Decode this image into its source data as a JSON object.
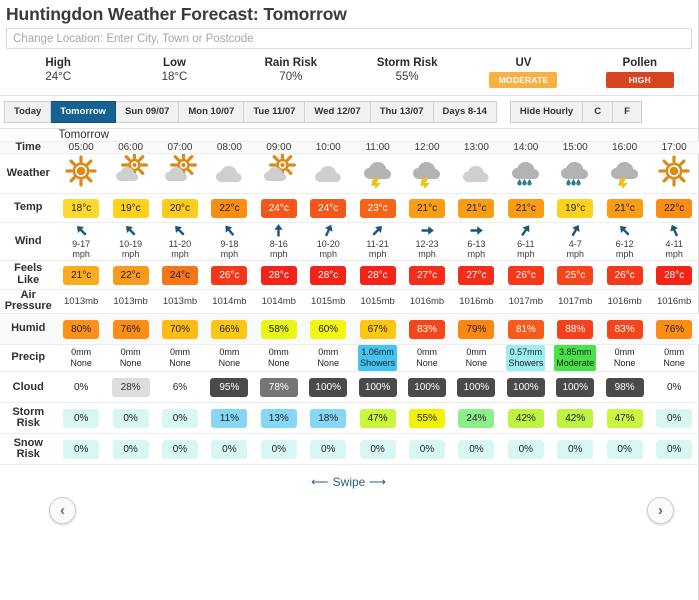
{
  "header": {
    "title": "Huntingdon Weather Forecast: Tomorrow",
    "search_placeholder": "Change Location: Enter City, Town or Postcode",
    "search_value": ""
  },
  "summary": [
    {
      "label": "High",
      "value": "24°C",
      "type": "text"
    },
    {
      "label": "Low",
      "value": "18°C",
      "type": "text"
    },
    {
      "label": "Rain Risk",
      "value": "70%",
      "type": "text"
    },
    {
      "label": "Storm Risk",
      "value": "55%",
      "type": "text"
    },
    {
      "label": "UV",
      "value": "MODERATE",
      "type": "badge",
      "color": "#F8B042"
    },
    {
      "label": "Pollen",
      "value": "HIGH",
      "type": "badge",
      "color": "#D6451F"
    }
  ],
  "tabs": {
    "days": [
      {
        "label": "Today",
        "active": false
      },
      {
        "label": "Tomorrow",
        "active": true
      },
      {
        "label": "Sun 09/07",
        "active": false
      },
      {
        "label": "Mon 10/07",
        "active": false
      },
      {
        "label": "Tue 11/07",
        "active": false
      },
      {
        "label": "Wed 12/07",
        "active": false
      },
      {
        "label": "Thu 13/07",
        "active": false
      },
      {
        "label": "Days 8-14",
        "active": false
      }
    ],
    "controls": [
      {
        "label": "Hide Hourly",
        "active": false
      },
      {
        "label": "C",
        "active": false
      },
      {
        "label": "F",
        "active": false
      }
    ],
    "active_tab_color": "#156192"
  },
  "nav": {
    "prev": "‹",
    "next": "›"
  },
  "footer": {
    "swipe_label": "Swipe",
    "left_arrow": "⟵",
    "right_arrow": "⟶"
  },
  "row_labels": {
    "time": "Time",
    "weather": "Weather",
    "temp": "Temp",
    "wind": "Wind",
    "feels_like": "Feels\nLike",
    "feels_like_l1": "Feels",
    "feels_like_l2": "Like",
    "pressure_l1": "Air",
    "pressure_l2": "Pressure",
    "humid": "Humid",
    "precip": "Precip",
    "cloud": "Cloud",
    "storm_l1": "Storm",
    "storm_l2": "Risk",
    "snow_l1": "Snow",
    "snow_l2": "Risk"
  },
  "day_banner": "Tomorrow",
  "chart_data": {
    "type": "table",
    "title": "Huntingdon Weather Forecast: Tomorrow",
    "categories": [
      "05:00",
      "06:00",
      "07:00",
      "08:00",
      "09:00",
      "10:00",
      "11:00",
      "12:00",
      "13:00",
      "14:00",
      "15:00",
      "16:00",
      "17:00"
    ],
    "xlabel": "Time",
    "series": [
      {
        "name": "Temp",
        "unit": "°c",
        "values": [
          18,
          19,
          20,
          22,
          24,
          24,
          23,
          21,
          21,
          21,
          19,
          21,
          22
        ]
      },
      {
        "name": "Feels Like",
        "unit": "°c",
        "values": [
          21,
          22,
          24,
          26,
          28,
          28,
          28,
          27,
          27,
          26,
          25,
          26,
          28
        ]
      },
      {
        "name": "Air Pressure",
        "unit": "mb",
        "values": [
          1013,
          1013,
          1013,
          1014,
          1014,
          1015,
          1015,
          1016,
          1016,
          1017,
          1017,
          1016,
          1016
        ]
      },
      {
        "name": "Humid",
        "unit": "%",
        "values": [
          80,
          76,
          70,
          66,
          58,
          60,
          67,
          83,
          79,
          81,
          88,
          83,
          76
        ]
      },
      {
        "name": "Cloud",
        "unit": "%",
        "values": [
          0,
          28,
          6,
          95,
          78,
          100,
          100,
          100,
          100,
          100,
          100,
          98,
          0
        ]
      },
      {
        "name": "Storm Risk",
        "unit": "%",
        "values": [
          0,
          0,
          0,
          11,
          13,
          18,
          47,
          55,
          24,
          42,
          42,
          47,
          0
        ]
      },
      {
        "name": "Snow Risk",
        "unit": "%",
        "values": [
          0,
          0,
          0,
          0,
          0,
          0,
          0,
          0,
          0,
          0,
          0,
          0,
          0
        ]
      },
      {
        "name": "Precip mm",
        "unit": "mm",
        "values": [
          0,
          0,
          0,
          0,
          0,
          0,
          1.06,
          0,
          0,
          0.57,
          3.85,
          0,
          0
        ]
      }
    ]
  },
  "columns": [
    {
      "time": "05:00",
      "weather": "sunny-icon",
      "temp": "18°c",
      "temp_color": "#FFD82B",
      "temp_text": "#222222",
      "wind_dir": "NW",
      "wind_rot": -45,
      "wind_speed": "9-17",
      "wind_unit": "mph",
      "feels": "21°c",
      "feels_color": "#FAAB1E",
      "feels_text": "#222222",
      "pressure": "1013mb",
      "humid": "80%",
      "humid_color": "#FB9217",
      "humid_text": "#222222",
      "precip_mm": "0mm",
      "precip_desc": "None",
      "precip_color": "transparent",
      "precip_text": "#222222",
      "cloud": "0%",
      "cloud_color": "#FFFFFF",
      "cloud_text": "#222222",
      "storm": "0%",
      "storm_color": "#D9F7F2",
      "storm_text": "#222222",
      "snow": "0%",
      "snow_color": "#D9F7F2",
      "snow_text": "#222222"
    },
    {
      "time": "06:00",
      "weather": "partly-sunny-icon",
      "temp": "19°c",
      "temp_color": "#FFD11F",
      "temp_text": "#222222",
      "wind_dir": "NW",
      "wind_rot": -45,
      "wind_speed": "10-19",
      "wind_unit": "mph",
      "feels": "22°c",
      "feels_color": "#F99A1C",
      "feels_text": "#222222",
      "pressure": "1013mb",
      "humid": "76%",
      "humid_color": "#FB8C14",
      "humid_text": "#222222",
      "precip_mm": "0mm",
      "precip_desc": "None",
      "precip_color": "transparent",
      "precip_text": "#222222",
      "cloud": "28%",
      "cloud_color": "#DDDDDD",
      "cloud_text": "#333333",
      "storm": "0%",
      "storm_color": "#D9F7F2",
      "storm_text": "#222222",
      "snow": "0%",
      "snow_color": "#D9F7F2",
      "snow_text": "#222222"
    },
    {
      "time": "07:00",
      "weather": "partly-sunny-icon",
      "temp": "20°c",
      "temp_color": "#FFCB1C",
      "temp_text": "#222222",
      "wind_dir": "NW",
      "wind_rot": -45,
      "wind_speed": "11-20",
      "wind_unit": "mph",
      "feels": "24°c",
      "feels_color": "#F5751A",
      "feels_text": "#222222",
      "pressure": "1013mb",
      "humid": "70%",
      "humid_color": "#FDBB13",
      "humid_text": "#222222",
      "precip_mm": "0mm",
      "precip_desc": "None",
      "precip_color": "transparent",
      "precip_text": "#222222",
      "cloud": "6%",
      "cloud_color": "#FFFFFF",
      "cloud_text": "#222222",
      "storm": "0%",
      "storm_color": "#D9F7F2",
      "storm_text": "#222222",
      "snow": "0%",
      "snow_color": "#D9F7F2",
      "snow_text": "#222222"
    },
    {
      "time": "08:00",
      "weather": "cloudy-icon",
      "temp": "22°c",
      "temp_color": "#FB8C14",
      "temp_text": "#222222",
      "wind_dir": "NW",
      "wind_rot": -40,
      "wind_speed": "9-18",
      "wind_unit": "mph",
      "feels": "26°c",
      "feels_color": "#F4391A",
      "feels_text": "#FFFFFF",
      "pressure": "1014mb",
      "humid": "66%",
      "humid_color": "#FDC711",
      "humid_text": "#222222",
      "precip_mm": "0mm",
      "precip_desc": "None",
      "precip_color": "transparent",
      "precip_text": "#222222",
      "cloud": "95%",
      "cloud_color": "#4A4A4A",
      "cloud_text": "#FFFFFF",
      "storm": "11%",
      "storm_color": "#86D7F6",
      "storm_text": "#222222",
      "snow": "0%",
      "snow_color": "#D9F7F2",
      "snow_text": "#222222"
    },
    {
      "time": "09:00",
      "weather": "partly-sunny-icon",
      "temp": "24°c",
      "temp_color": "#F5571A",
      "temp_text": "#FFFFFF",
      "wind_dir": "N",
      "wind_rot": 0,
      "wind_speed": "8-16",
      "wind_unit": "mph",
      "feels": "28°c",
      "feels_color": "#F22318",
      "feels_text": "#FFFFFF",
      "pressure": "1014mb",
      "humid": "58%",
      "humid_color": "#EAF615",
      "humid_text": "#222222",
      "precip_mm": "0mm",
      "precip_desc": "None",
      "precip_color": "transparent",
      "precip_text": "#222222",
      "cloud": "78%",
      "cloud_color": "#757575",
      "cloud_text": "#FFFFFF",
      "storm": "13%",
      "storm_color": "#86D7F6",
      "storm_text": "#222222",
      "snow": "0%",
      "snow_color": "#D9F7F2",
      "snow_text": "#222222"
    },
    {
      "time": "10:00",
      "weather": "cloudy-icon",
      "temp": "24°c",
      "temp_color": "#F5571A",
      "temp_text": "#FFFFFF",
      "wind_dir": "NNE",
      "wind_rot": 25,
      "wind_speed": "10-20",
      "wind_unit": "mph",
      "feels": "28°c",
      "feels_color": "#F22318",
      "feels_text": "#FFFFFF",
      "pressure": "1015mb",
      "humid": "60%",
      "humid_color": "#F1F613",
      "humid_text": "#222222",
      "precip_mm": "0mm",
      "precip_desc": "None",
      "precip_color": "transparent",
      "precip_text": "#222222",
      "cloud": "100%",
      "cloud_color": "#4A4A4A",
      "cloud_text": "#FFFFFF",
      "storm": "18%",
      "storm_color": "#86D7F6",
      "storm_text": "#222222",
      "snow": "0%",
      "snow_color": "#D9F7F2",
      "snow_text": "#222222"
    },
    {
      "time": "11:00",
      "weather": "thunder-icon",
      "temp": "23°c",
      "temp_color": "#F5641A",
      "temp_text": "#FFFFFF",
      "wind_dir": "NE",
      "wind_rot": 45,
      "wind_speed": "11-21",
      "wind_unit": "mph",
      "feels": "28°c",
      "feels_color": "#F22318",
      "feels_text": "#FFFFFF",
      "pressure": "1015mb",
      "humid": "67%",
      "humid_color": "#FDC711",
      "humid_text": "#222222",
      "precip_mm": "1.06mm",
      "precip_desc": "Showers",
      "precip_color": "#44C4F0",
      "precip_text": "#222222",
      "cloud": "100%",
      "cloud_color": "#4A4A4A",
      "cloud_text": "#FFFFFF",
      "storm": "47%",
      "storm_color": "#CCF53E",
      "storm_text": "#222222",
      "snow": "0%",
      "snow_color": "#D9F7F2",
      "snow_text": "#222222"
    },
    {
      "time": "12:00",
      "weather": "thunder-icon",
      "temp": "21°c",
      "temp_color": "#FB9C15",
      "temp_text": "#222222",
      "wind_dir": "E",
      "wind_rot": 90,
      "wind_speed": "12-23",
      "wind_unit": "mph",
      "feels": "27°c",
      "feels_color": "#F32D19",
      "feels_text": "#FFFFFF",
      "pressure": "1016mb",
      "humid": "83%",
      "humid_color": "#F4451B",
      "humid_text": "#FFFFFF",
      "precip_mm": "0mm",
      "precip_desc": "None",
      "precip_color": "transparent",
      "precip_text": "#222222",
      "cloud": "100%",
      "cloud_color": "#4A4A4A",
      "cloud_text": "#FFFFFF",
      "storm": "55%",
      "storm_color": "#F2F203",
      "storm_text": "#222222",
      "snow": "0%",
      "snow_color": "#D9F7F2",
      "snow_text": "#222222"
    },
    {
      "time": "13:00",
      "weather": "cloudy-icon",
      "temp": "21°c",
      "temp_color": "#FB9C15",
      "temp_text": "#222222",
      "wind_dir": "E",
      "wind_rot": 90,
      "wind_speed": "6-13",
      "wind_unit": "mph",
      "feels": "27°c",
      "feels_color": "#F32D19",
      "feels_text": "#FFFFFF",
      "pressure": "1016mb",
      "humid": "79%",
      "humid_color": "#FB8712",
      "humid_text": "#222222",
      "precip_mm": "0mm",
      "precip_desc": "None",
      "precip_color": "transparent",
      "precip_text": "#222222",
      "cloud": "100%",
      "cloud_color": "#4A4A4A",
      "cloud_text": "#FFFFFF",
      "storm": "24%",
      "storm_color": "#8BF08B",
      "storm_text": "#222222",
      "snow": "0%",
      "snow_color": "#D9F7F2",
      "snow_text": "#222222"
    },
    {
      "time": "14:00",
      "weather": "rain-icon",
      "temp": "21°c",
      "temp_color": "#FB9C15",
      "temp_text": "#222222",
      "wind_dir": "NE",
      "wind_rot": 35,
      "wind_speed": "6-11",
      "wind_unit": "mph",
      "feels": "26°c",
      "feels_color": "#F4391A",
      "feels_text": "#FFFFFF",
      "pressure": "1017mb",
      "humid": "81%",
      "humid_color": "#F75A1B",
      "humid_text": "#FFFFFF",
      "precip_mm": "0.57mm",
      "precip_desc": "Showers",
      "precip_color": "#9DEDF5",
      "precip_text": "#222222",
      "cloud": "100%",
      "cloud_color": "#4A4A4A",
      "cloud_text": "#FFFFFF",
      "storm": "42%",
      "storm_color": "#BDF442",
      "storm_text": "#222222",
      "snow": "0%",
      "snow_color": "#D9F7F2",
      "snow_text": "#222222"
    },
    {
      "time": "15:00",
      "weather": "rain-icon",
      "temp": "19°c",
      "temp_color": "#FFD11F",
      "temp_text": "#222222",
      "wind_dir": "NE",
      "wind_rot": 30,
      "wind_speed": "4-7",
      "wind_unit": "mph",
      "feels": "25°c",
      "feels_color": "#F5451A",
      "feels_text": "#FFFFFF",
      "pressure": "1017mb",
      "humid": "88%",
      "humid_color": "#F4401B",
      "humid_text": "#FFFFFF",
      "precip_mm": "3.85mm",
      "precip_desc": "Moderate",
      "precip_color": "#4AE24A",
      "precip_text": "#222222",
      "cloud": "100%",
      "cloud_color": "#4A4A4A",
      "cloud_text": "#FFFFFF",
      "storm": "42%",
      "storm_color": "#BDF442",
      "storm_text": "#222222",
      "snow": "0%",
      "snow_color": "#D9F7F2",
      "snow_text": "#222222"
    },
    {
      "time": "16:00",
      "weather": "thunder-icon",
      "temp": "21°c",
      "temp_color": "#FB9C15",
      "temp_text": "#222222",
      "wind_dir": "NW",
      "wind_rot": -45,
      "wind_speed": "6-12",
      "wind_unit": "mph",
      "feels": "26°c",
      "feels_color": "#F4391A",
      "feels_text": "#FFFFFF",
      "pressure": "1016mb",
      "humid": "83%",
      "humid_color": "#F4451B",
      "humid_text": "#FFFFFF",
      "precip_mm": "0mm",
      "precip_desc": "None",
      "precip_color": "transparent",
      "precip_text": "#222222",
      "cloud": "98%",
      "cloud_color": "#4A4A4A",
      "cloud_text": "#FFFFFF",
      "storm": "47%",
      "storm_color": "#CCF53E",
      "storm_text": "#222222",
      "snow": "0%",
      "snow_color": "#D9F7F2",
      "snow_text": "#222222"
    },
    {
      "time": "17:00",
      "weather": "sunny-icon",
      "temp": "22°c",
      "temp_color": "#FB8C14",
      "temp_text": "#222222",
      "wind_dir": "NNW",
      "wind_rot": -25,
      "wind_speed": "4-11",
      "wind_unit": "mph",
      "feels": "28°c",
      "feels_color": "#F22318",
      "feels_text": "#FFFFFF",
      "pressure": "1016mb",
      "humid": "76%",
      "humid_color": "#FB8C14",
      "humid_text": "#222222",
      "precip_mm": "0mm",
      "precip_desc": "None",
      "precip_color": "transparent",
      "precip_text": "#222222",
      "cloud": "0%",
      "cloud_color": "#FFFFFF",
      "cloud_text": "#222222",
      "storm": "0%",
      "storm_color": "#D9F7F2",
      "storm_text": "#222222",
      "snow": "0%",
      "snow_color": "#D9F7F2",
      "snow_text": "#222222"
    }
  ]
}
